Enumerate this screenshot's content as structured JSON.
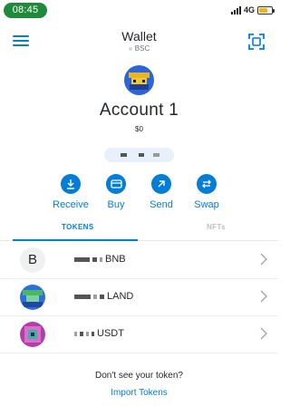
{
  "status_bar": {
    "time": "08:45",
    "network": "4G"
  },
  "header": {
    "title": "Wallet",
    "network": "BSC"
  },
  "account": {
    "name": "Account 1",
    "balance": "$0"
  },
  "actions": [
    {
      "label": "Receive",
      "icon": "download-icon"
    },
    {
      "label": "Buy",
      "icon": "card-icon"
    },
    {
      "label": "Send",
      "icon": "arrow-up-right-icon"
    },
    {
      "label": "Swap",
      "icon": "swap-icon"
    }
  ],
  "tabs": {
    "tokens": "TOKENS",
    "nfts": "NFTs"
  },
  "tokens": [
    {
      "symbol": "BNB",
      "icon_letter": "B"
    },
    {
      "symbol": "LAND"
    },
    {
      "symbol": "USDT"
    }
  ],
  "footer": {
    "question": "Don't see your token?",
    "link": "Import Tokens"
  },
  "colors": {
    "accent": "#037dd6",
    "status_green": "#1f8a3b",
    "text": "#24272a"
  }
}
